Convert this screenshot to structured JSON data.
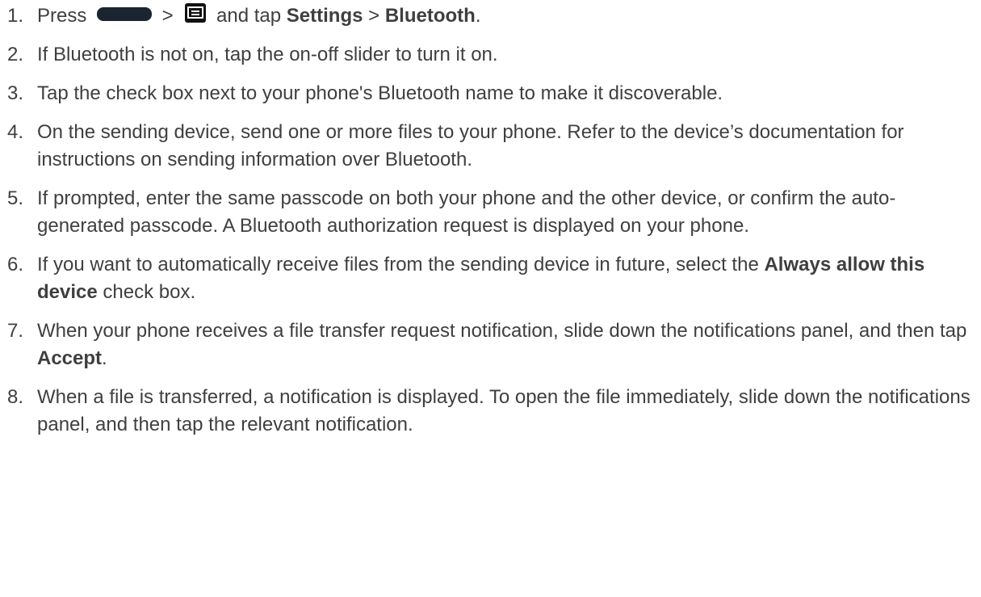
{
  "steps": [
    {
      "num": "1.",
      "parts": [
        {
          "t": "Press "
        },
        {
          "icon": "home-key-icon"
        },
        {
          "t": " > "
        },
        {
          "icon": "menu-key-icon"
        },
        {
          "t": " and tap "
        },
        {
          "b": "Settings"
        },
        {
          "t": " > "
        },
        {
          "b": "Bluetooth"
        },
        {
          "t": "."
        }
      ]
    },
    {
      "num": "2.",
      "parts": [
        {
          "t": "If Bluetooth is not on, tap the on-off slider to turn it on."
        }
      ]
    },
    {
      "num": "3.",
      "parts": [
        {
          "t": "Tap the check box next to your phone's Bluetooth name to make it discoverable."
        }
      ]
    },
    {
      "num": "4.",
      "parts": [
        {
          "t": "On the sending device, send one or more files to your phone. Refer to the device’s documentation for instructions on sending information over Bluetooth."
        }
      ]
    },
    {
      "num": "5.",
      "parts": [
        {
          "t": "If prompted, enter the same passcode on both your phone and the other device, or confirm the auto-generated passcode. A Bluetooth authorization request is displayed on your phone."
        }
      ]
    },
    {
      "num": "6.",
      "parts": [
        {
          "t": "If you want to automatically receive files from the sending device in future, select the "
        },
        {
          "b": "Always allow this device"
        },
        {
          "t": " check box."
        }
      ]
    },
    {
      "num": "7.",
      "parts": [
        {
          "t": "When your phone receives a file transfer request notification, slide down the notifications panel, and then tap "
        },
        {
          "b": "Accept"
        },
        {
          "t": "."
        }
      ]
    },
    {
      "num": "8.",
      "parts": [
        {
          "t": "When a file is transferred, a notification is displayed. To open the file immediately, slide down the notifications panel, and then tap the relevant notification."
        }
      ]
    }
  ]
}
